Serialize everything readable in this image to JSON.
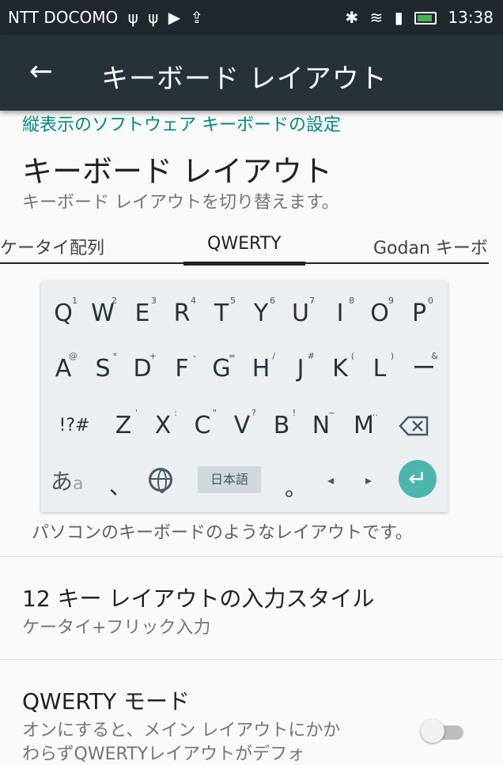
{
  "status_bar": {
    "carrier": "NTT DOCOMO",
    "icons": [
      "usb-icon",
      "usb-icon",
      "play-store-icon",
      "upload-icon"
    ],
    "right_icons": [
      "bluetooth-icon",
      "wifi-icon",
      "signal-icon",
      "battery-icon"
    ],
    "time": "13:38",
    "battery_color": "#4caf50"
  },
  "app_bar": {
    "title": "キーボード レイアウト",
    "back_icon": "back-arrow-icon",
    "background": "#263238"
  },
  "section": {
    "header": "縦表示のソフトウェア キーボードの設定",
    "header_color": "#00897b"
  },
  "keyboard_layout": {
    "title": "キーボード レイアウト",
    "summary": "キーボード レイアウトを切り替えます。",
    "tabs": [
      "ケータイ配列",
      "QWERTY",
      "Godan キーボ"
    ],
    "selected_tab": "QWERTY",
    "description": "パソコンのキーボードのようなレイアウトです。"
  },
  "keyboard_preview": {
    "row1": [
      {
        "key": "Q",
        "hint": "1"
      },
      {
        "key": "W",
        "hint": "2"
      },
      {
        "key": "E",
        "hint": "3"
      },
      {
        "key": "R",
        "hint": "4"
      },
      {
        "key": "T",
        "hint": "5"
      },
      {
        "key": "Y",
        "hint": "6"
      },
      {
        "key": "U",
        "hint": "7"
      },
      {
        "key": "I",
        "hint": "8"
      },
      {
        "key": "O",
        "hint": "9"
      },
      {
        "key": "P",
        "hint": "0"
      }
    ],
    "row2": [
      {
        "key": "A",
        "hint": "@"
      },
      {
        "key": "S",
        "hint": "*"
      },
      {
        "key": "D",
        "hint": "+"
      },
      {
        "key": "F",
        "hint": "-"
      },
      {
        "key": "G",
        "hint": "="
      },
      {
        "key": "H",
        "hint": "/"
      },
      {
        "key": "J",
        "hint": "#"
      },
      {
        "key": "K",
        "hint": "("
      },
      {
        "key": "L",
        "hint": ")"
      },
      {
        "key": "ー",
        "hint": "&"
      }
    ],
    "row3": [
      {
        "key": "!?#",
        "hint": ""
      },
      {
        "key": "Z",
        "hint": "'"
      },
      {
        "key": "X",
        "hint": ":"
      },
      {
        "key": "C",
        "hint": "\""
      },
      {
        "key": "V",
        "hint": "?"
      },
      {
        "key": "B",
        "hint": "!"
      },
      {
        "key": "N",
        "hint": "~"
      },
      {
        "key": "M",
        "hint": "…"
      }
    ],
    "bottom_kana": "あ",
    "bottom_kana_small": "a",
    "comma": "、",
    "lang_label": "日本語",
    "period": "。",
    "left_arrow": "◂",
    "right_arrow": "▸",
    "enter_glyph": "↵",
    "enter_color": "#4db6ac"
  },
  "input_style": {
    "title": "12 キー レイアウトの入力スタイル",
    "summary": "ケータイ+フリック入力"
  },
  "qwerty_mode": {
    "title": "QWERTY モード",
    "summary_line1": "オンにすると、メイン レイアウトにかか",
    "summary_line2": "わらずQWERTYレイアウトがデフォ",
    "toggle_on": false
  }
}
